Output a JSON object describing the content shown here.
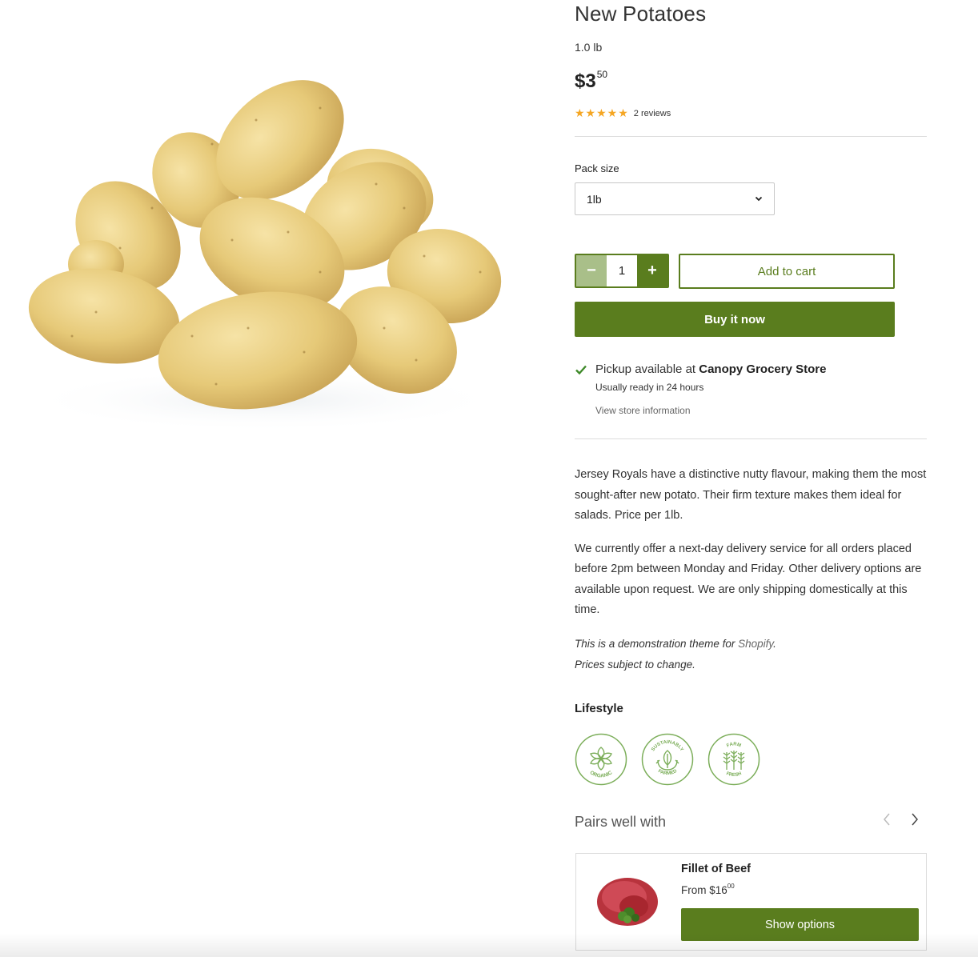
{
  "product": {
    "title": "New Potatoes",
    "weight": "1.0 lb",
    "price_dollars": "$3",
    "price_cents": "50",
    "rating_stars": 4.5,
    "stars_glyphs": "★★★★★",
    "reviews": "2 reviews"
  },
  "options": {
    "pack_label": "Pack size",
    "pack_value": "1lb"
  },
  "cart": {
    "quantity": "1",
    "minus": "−",
    "plus": "+",
    "add_to_cart": "Add to cart",
    "buy_now": "Buy it now"
  },
  "pickup": {
    "prefix": "Pickup available at ",
    "store": "Canopy Grocery Store",
    "ready": "Usually ready in 24 hours",
    "view_store": "View store information"
  },
  "description": {
    "p1": "Jersey Royals have a distinctive nutty flavour, making them the most sought-after new potato. Their firm texture makes them ideal for salads. Price per 1lb.",
    "p2": "We currently offer a next-day delivery service for all orders placed before 2pm between Monday and Friday. Other delivery options are available upon request. We are only shipping domestically at this time.",
    "note_prefix": "This is a demonstration theme for ",
    "note_link": "Shopify",
    "note_suffix": ".",
    "note_line2": "Prices subject to change."
  },
  "lifestyle": {
    "title": "Lifestyle",
    "badges": [
      {
        "top": "",
        "bottom": "ORGANIC",
        "icon": "organic-icon"
      },
      {
        "top": "SUSTAINABLY",
        "bottom": "FARMED",
        "icon": "sustainably-farmed-icon"
      },
      {
        "top": "FARM",
        "bottom": "FRESH",
        "icon": "farm-fresh-icon"
      }
    ]
  },
  "pairs": {
    "title": "Pairs well with",
    "item": {
      "name": "Fillet of Beef",
      "price_prefix": "From $16",
      "price_cents": "00",
      "button": "Show options"
    }
  },
  "colors": {
    "accent": "#5a7d1e",
    "accent_light": "#a9bf89",
    "star": "#f5a623",
    "badge": "#7cae5a"
  }
}
